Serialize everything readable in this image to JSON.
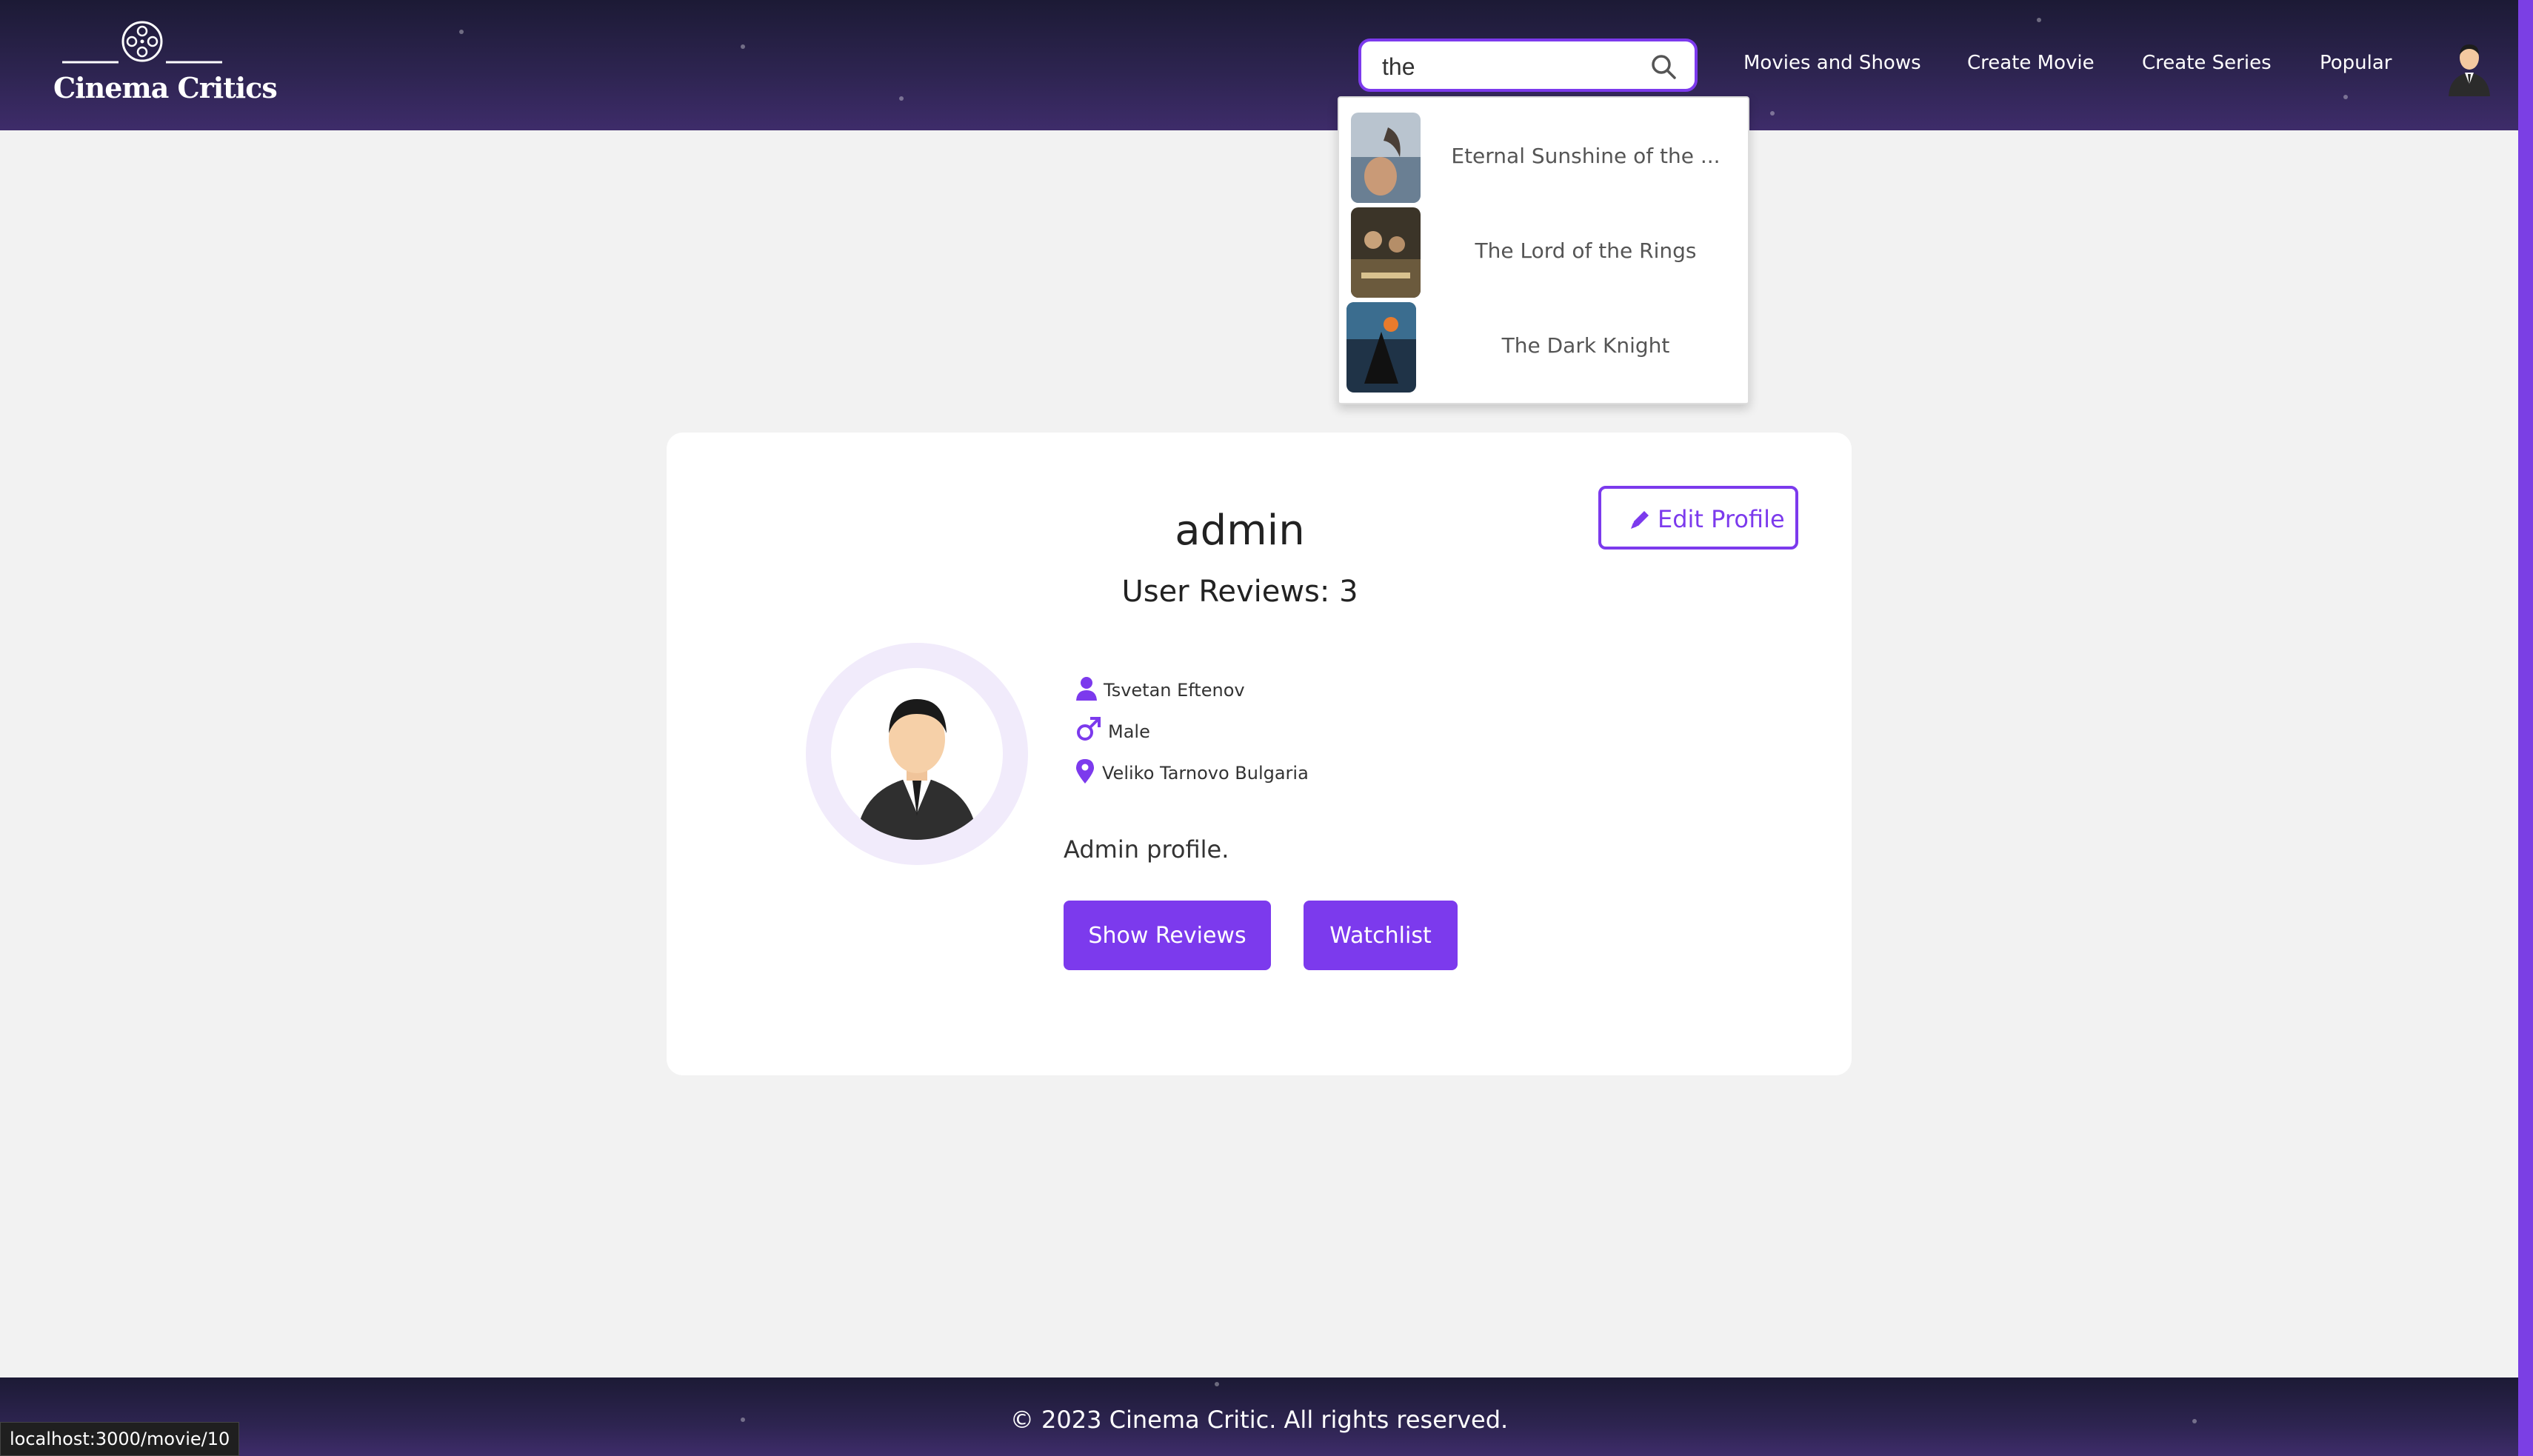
{
  "app": {
    "brand": "Cinema Critics",
    "accent_color": "#7c3aed",
    "header_color": "#2d2450"
  },
  "search": {
    "value": "the",
    "icon": "search-icon"
  },
  "nav": {
    "items": [
      {
        "label": "Movies and Shows"
      },
      {
        "label": "Create Movie"
      },
      {
        "label": "Create Series"
      },
      {
        "label": "Popular"
      }
    ],
    "avatar_icon": "user-avatar"
  },
  "search_results": [
    {
      "title": "Eternal Sunshine of the ..."
    },
    {
      "title": "The Lord of the Rings"
    },
    {
      "title": "The Dark Knight"
    }
  ],
  "profile": {
    "username": "admin",
    "reviews_label": "User Reviews: 3",
    "edit_label": "Edit Profile",
    "full_name": "Tsvetan Eftenov",
    "gender": "Male",
    "location": "Veliko Tarnovo Bulgaria",
    "bio": "Admin profile.",
    "show_reviews_label": "Show Reviews",
    "watchlist_label": "Watchlist"
  },
  "footer": {
    "text": "© 2023 Cinema Critic. All rights reserved."
  },
  "status_bar": {
    "url": "localhost:3000/movie/10"
  }
}
